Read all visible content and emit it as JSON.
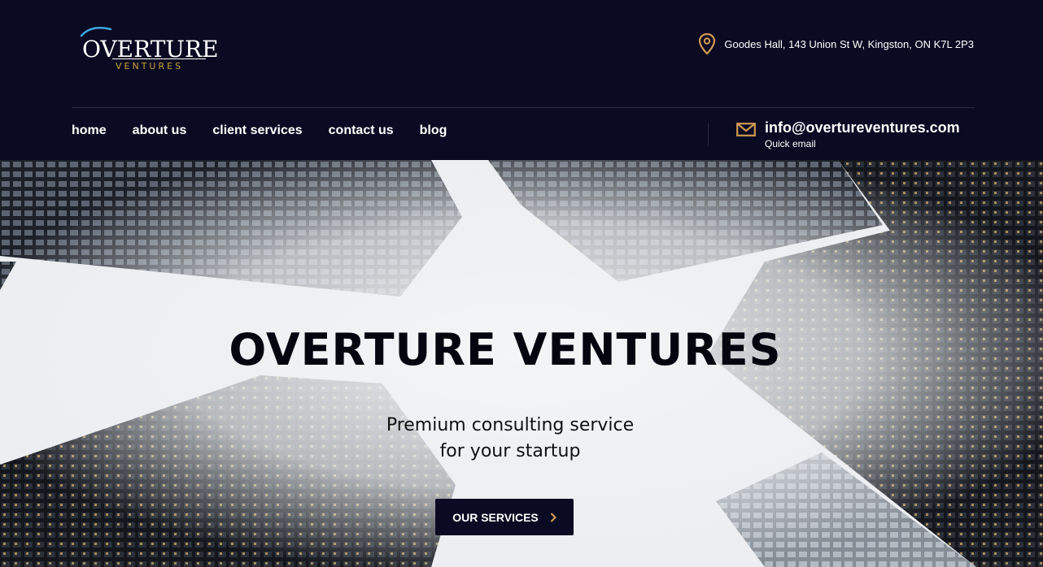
{
  "header": {
    "logo": {
      "word_top": "OVERTURE",
      "word_bottom": "VENTURES"
    },
    "address": "Goodes Hall, 143 Union St W, Kingston, ON K7L 2P3",
    "nav": [
      {
        "label": "home"
      },
      {
        "label": "about us"
      },
      {
        "label": "client services"
      },
      {
        "label": "contact us"
      },
      {
        "label": "blog"
      }
    ],
    "email": {
      "address": "info@overtureventures.com",
      "caption": "Quick email"
    }
  },
  "hero": {
    "title": "OVERTURE VENTURES",
    "subtitle_line1": "Premium consulting service",
    "subtitle_line2": "for your startup",
    "cta_label": "OUR SERVICES"
  },
  "colors": {
    "header_bg": "#0a0a22",
    "accent_gold": "#d09a52",
    "logo_gold": "#c9a13a",
    "cta_bg": "#0a0a22"
  },
  "icons": {
    "address": "map-pin-icon",
    "email": "envelope-icon",
    "cta": "chevron-right-icon"
  }
}
